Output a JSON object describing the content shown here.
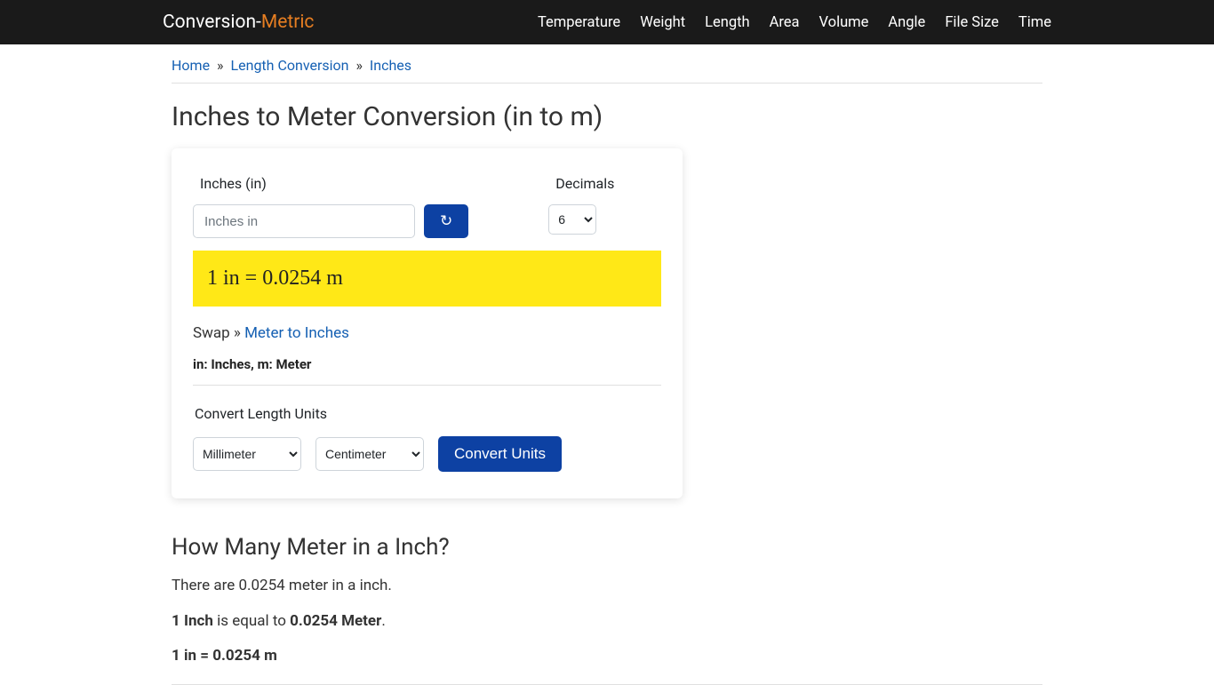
{
  "logo": {
    "part1": "Conversion-",
    "part2": "Metric"
  },
  "nav": {
    "items": [
      "Temperature",
      "Weight",
      "Length",
      "Area",
      "Volume",
      "Angle",
      "File Size",
      "Time"
    ]
  },
  "breadcrumb": {
    "home": "Home",
    "sep": "»",
    "level1": "Length Conversion",
    "level2": "Inches"
  },
  "page_title": "Inches to Meter Conversion (in to m)",
  "calc": {
    "input_label": "Inches (in)",
    "input_placeholder": "Inches in",
    "refresh_icon": "↻",
    "decimals_label": "Decimals",
    "decimals_value": "6",
    "result": "1 in = 0.0254 m",
    "swap_prefix": "Swap » ",
    "swap_link": "Meter to Inches",
    "legend": "in: Inches, m: Meter",
    "convert_label": "Convert Length Units",
    "from_unit": "Millimeter",
    "to_unit": "Centimeter",
    "convert_button": "Convert Units"
  },
  "article": {
    "heading": "How Many Meter in a Inch?",
    "line1": "There are 0.0254 meter in a inch.",
    "line2_b1": "1 Inch",
    "line2_mid": " is equal to ",
    "line2_b2": "0.0254 Meter",
    "line2_end": ".",
    "line3": "1 in = 0.0254 m"
  }
}
